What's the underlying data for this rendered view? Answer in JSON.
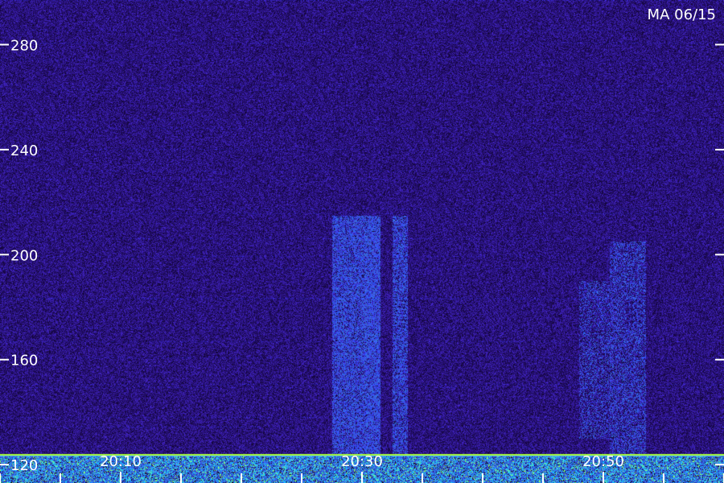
{
  "corner_label": "MA 06/15",
  "colors": {
    "background": "#2a1470",
    "noise_bright": "#3a2aa0",
    "burst": "#3f5cff",
    "baseline_line": "#a8ff3a",
    "low_band": "#1a8cff",
    "tick": "#ffffff"
  },
  "chart_data": {
    "type": "heatmap",
    "title": "",
    "xlabel": "",
    "ylabel": "",
    "y_ticks": [
      120,
      160,
      200,
      240,
      280
    ],
    "x_tick_labels": [
      "20:10",
      "20:30",
      "20:50"
    ],
    "x_minor_tick_count": 3,
    "ylim": [
      113,
      297
    ],
    "xlim_minutes": [
      0,
      60
    ],
    "x_label_minutes": [
      10,
      30,
      50
    ],
    "baseline_level": 124,
    "bursts": [
      {
        "t_start": 27.5,
        "t_end": 30.2,
        "y_low": 122,
        "y_high": 215,
        "intensity": 0.75
      },
      {
        "t_start": 30.2,
        "t_end": 31.5,
        "y_low": 122,
        "y_high": 215,
        "intensity": 0.85
      },
      {
        "t_start": 32.5,
        "t_end": 33.8,
        "y_low": 122,
        "y_high": 215,
        "intensity": 0.65
      },
      {
        "t_start": 48.0,
        "t_end": 50.5,
        "y_low": 130,
        "y_high": 190,
        "intensity": 0.35
      },
      {
        "t_start": 50.5,
        "t_end": 53.5,
        "y_low": 122,
        "y_high": 205,
        "intensity": 0.45
      }
    ]
  }
}
